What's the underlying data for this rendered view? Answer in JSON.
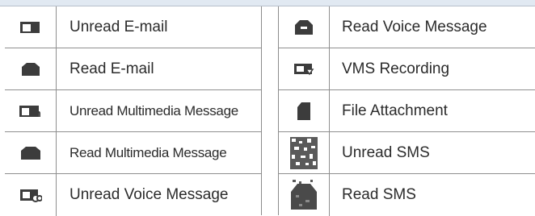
{
  "left_column": [
    {
      "icon": "unread-email-icon",
      "label": "Unread E-mail"
    },
    {
      "icon": "read-email-icon",
      "label": "Read E-mail"
    },
    {
      "icon": "unread-multimedia-message-icon",
      "label": "Unread Multimedia Message"
    },
    {
      "icon": "read-multimedia-message-icon",
      "label": "Read Multimedia Message"
    },
    {
      "icon": "unread-voice-message-icon",
      "label": "Unread Voice Message"
    }
  ],
  "right_column": [
    {
      "icon": "read-voice-message-icon",
      "label": "Read Voice Message"
    },
    {
      "icon": "vms-recording-icon",
      "label": "VMS Recording"
    },
    {
      "icon": "file-attachment-icon",
      "label": "File Attachment"
    },
    {
      "icon": "unread-sms-icon",
      "label": "Unread SMS"
    },
    {
      "icon": "read-sms-icon",
      "label": "Read SMS"
    }
  ]
}
